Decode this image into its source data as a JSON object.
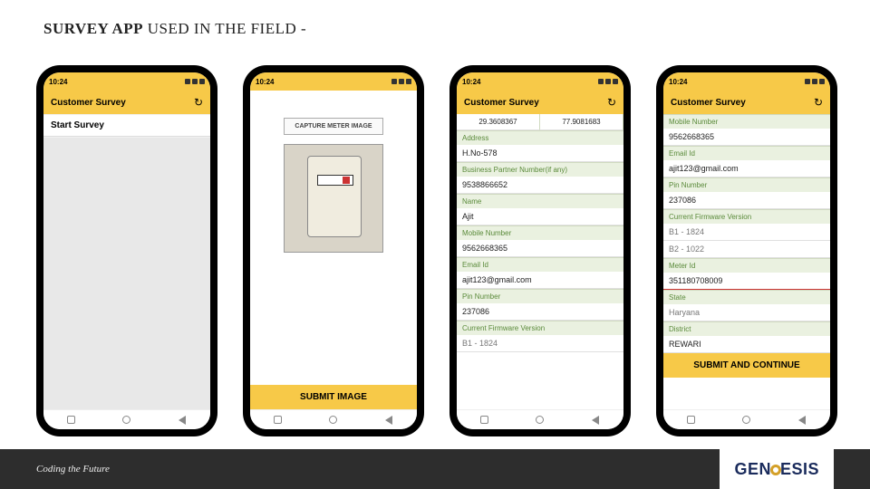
{
  "title": {
    "bold": "SURVEY APP",
    "reg": " USED IN THE FIELD -"
  },
  "status_time": "10:24",
  "header_title": "Customer Survey",
  "phone1": {
    "start": "Start Survey"
  },
  "phone2": {
    "capture": "CAPTURE METER IMAGE",
    "submit": "SUBMIT IMAGE"
  },
  "phone3": {
    "lat": "29.3608367",
    "lon": "77.9081683",
    "labels": [
      "Address",
      "Business Partner Number(if any)",
      "Name",
      "Mobile Number",
      "Email Id",
      "Pin Number",
      "Current Firmware Version"
    ],
    "values": [
      "H.No-578",
      "9538866652",
      "Ajit",
      "9562668365",
      "ajit123@gmail.com",
      "237086",
      "B1 - 1824"
    ]
  },
  "phone4": {
    "labels": [
      "Mobile Number",
      "Email Id",
      "Pin Number",
      "Current Firmware Version",
      "",
      "Meter Id",
      "State",
      "",
      "District"
    ],
    "values": [
      "9562668365",
      "ajit123@gmail.com",
      "237086",
      "B1 - 1824",
      "B2 - 1022",
      "351180708009",
      "",
      "Haryana",
      "REWARI"
    ],
    "submit": "SUBMIT AND CONTINUE"
  },
  "footer": "Coding the Future",
  "logo": {
    "pre": "GEN",
    "post": "ESIS"
  }
}
